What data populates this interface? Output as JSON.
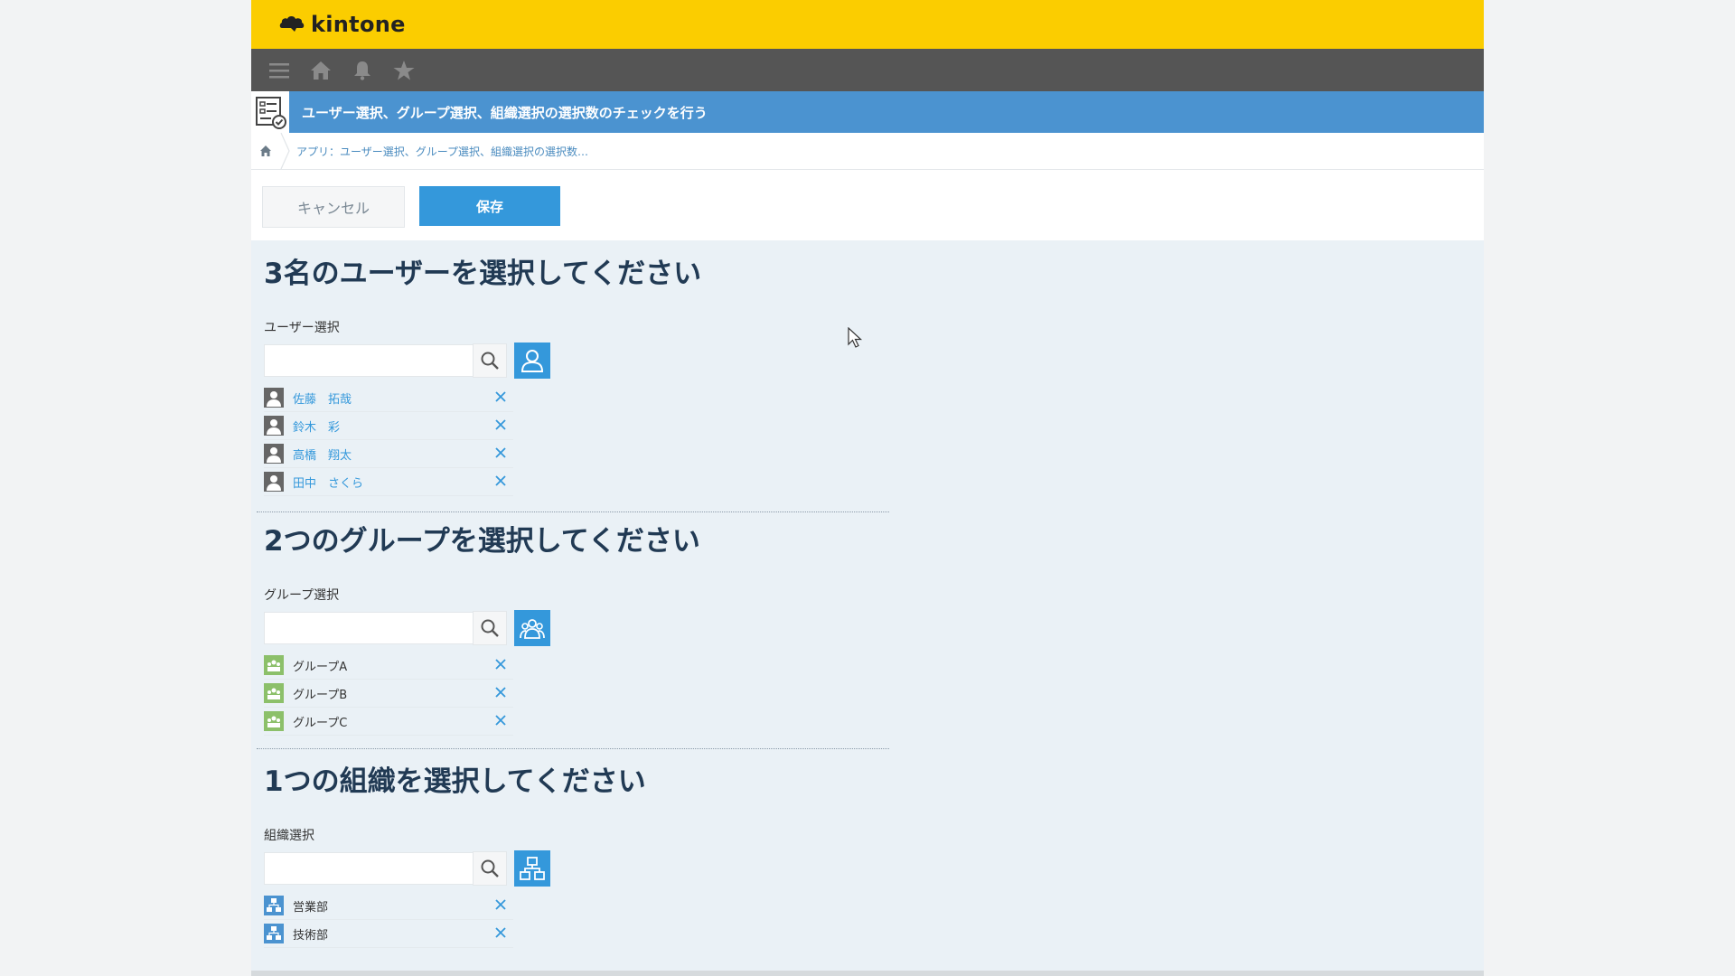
{
  "header": {
    "logo_text": "kintone"
  },
  "navbar": {
    "icons": [
      "menu-icon",
      "home-icon",
      "bell-icon",
      "star-icon"
    ]
  },
  "app": {
    "title": "ユーザー選択、グループ選択、組織選択の選択数のチェックを行う"
  },
  "breadcrumb": {
    "text": "アプリ：ユーザー選択、グループ選択、組織選択の選択数…"
  },
  "actions": {
    "cancel_label": "キャンセル",
    "save_label": "保存"
  },
  "sections": {
    "users": {
      "title": "3名のユーザーを選択してください",
      "field_label": "ユーザー選択",
      "items": [
        "佐藤　拓哉",
        "鈴木　彩",
        "高橋　翔太",
        "田中　さくら"
      ]
    },
    "groups": {
      "title": "2つのグループを選択してください",
      "field_label": "グループ選択",
      "items": [
        "グループA",
        "グループB",
        "グループC"
      ]
    },
    "orgs": {
      "title": "1つの組織を選択してください",
      "field_label": "組織選択",
      "items": [
        "営業部",
        "技術部"
      ]
    }
  },
  "colors": {
    "topbar": "#fbcd00",
    "navbar": "#555555",
    "appbar": "#4b93d0",
    "accent": "#3498db",
    "group_icon": "#8cc06a",
    "heading": "#213a54"
  }
}
